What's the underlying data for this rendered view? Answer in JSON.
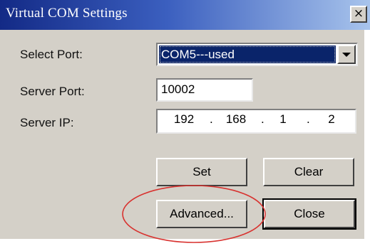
{
  "window": {
    "title": "Virtual COM Settings",
    "close_glyph": "×"
  },
  "form": {
    "select_port_label": "Select Port:",
    "select_port_value": "COM5---used",
    "server_port_label": "Server Port:",
    "server_port_value": "10002",
    "server_ip_label": "Server IP:",
    "server_ip": [
      "192",
      "168",
      "1",
      "2"
    ],
    "ip_separator": "."
  },
  "buttons": {
    "set": "Set",
    "clear": "Clear",
    "advanced": "Advanced...",
    "close": "Close"
  },
  "icons": {
    "close": "close-icon",
    "dropdown": "chevron-down-icon"
  },
  "colors": {
    "annotation": "#d8322f",
    "selection": "#0a246a"
  }
}
